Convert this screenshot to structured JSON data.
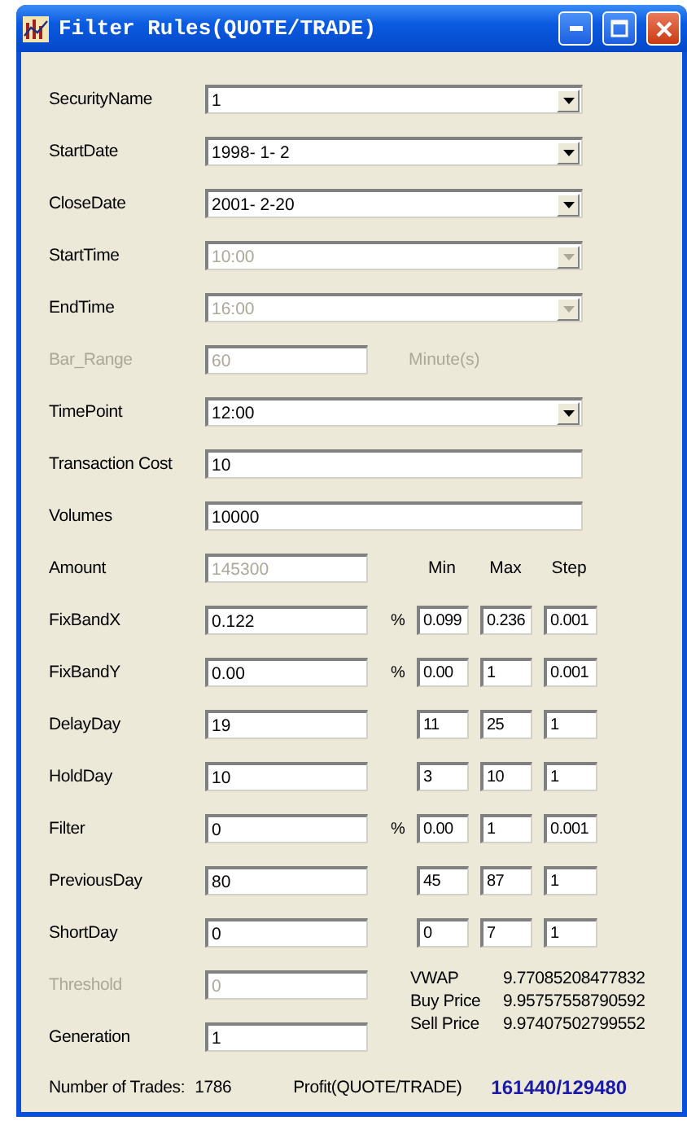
{
  "window": {
    "title": "Filter Rules(QUOTE/TRADE)"
  },
  "rows": [
    {
      "kind": "combo",
      "label": "SecurityName",
      "label_disabled": false,
      "value": "1",
      "disabled": false
    },
    {
      "kind": "combo",
      "label": "StartDate",
      "label_disabled": false,
      "value": "1998- 1- 2",
      "disabled": false
    },
    {
      "kind": "combo",
      "label": "CloseDate",
      "label_disabled": false,
      "value": "2001- 2-20",
      "disabled": false
    },
    {
      "kind": "combo",
      "label": "StartTime",
      "label_disabled": false,
      "value": "10:00",
      "disabled": true
    },
    {
      "kind": "combo",
      "label": "EndTime",
      "label_disabled": false,
      "value": "16:00",
      "disabled": true
    },
    {
      "kind": "short",
      "label": "Bar_Range",
      "label_disabled": true,
      "value": "60",
      "disabled": true,
      "unit": "Minute(s)"
    },
    {
      "kind": "combo",
      "label": "TimePoint",
      "label_disabled": false,
      "value": "12:00",
      "disabled": false
    },
    {
      "kind": "text",
      "label": "Transaction Cost",
      "label_disabled": false,
      "value": "10",
      "disabled": false
    },
    {
      "kind": "text",
      "label": "Volumes",
      "label_disabled": false,
      "value": "10000",
      "disabled": false
    },
    {
      "kind": "short",
      "label": "Amount",
      "label_disabled": false,
      "value": "145300",
      "disabled": true,
      "headers": [
        "Min",
        "Max",
        "Step"
      ]
    },
    {
      "kind": "range",
      "label": "FixBandX",
      "label_disabled": false,
      "value": "0.122",
      "disabled": false,
      "unit": "%",
      "min": "0.099",
      "max": "0.236",
      "step": "0.001"
    },
    {
      "kind": "range",
      "label": "FixBandY",
      "label_disabled": false,
      "value": "0.00",
      "disabled": false,
      "unit": "%",
      "min": "0.00",
      "max": "1",
      "step": "0.001"
    },
    {
      "kind": "range",
      "label": "DelayDay",
      "label_disabled": false,
      "value": "19",
      "disabled": false,
      "min": "11",
      "max": "25",
      "step": "1"
    },
    {
      "kind": "range",
      "label": "HoldDay",
      "label_disabled": false,
      "value": "10",
      "disabled": false,
      "min": "3",
      "max": "10",
      "step": "1"
    },
    {
      "kind": "range",
      "label": "Filter",
      "label_disabled": false,
      "value": "0",
      "disabled": false,
      "unit": "%",
      "min": "0.00",
      "max": "1",
      "step": "0.001"
    },
    {
      "kind": "range",
      "label": "PreviousDay",
      "label_disabled": false,
      "value": "80",
      "disabled": false,
      "min": "45",
      "max": "87",
      "step": "1"
    },
    {
      "kind": "range",
      "label": "ShortDay",
      "label_disabled": false,
      "value": "0",
      "disabled": false,
      "min": "0",
      "max": "7",
      "step": "1"
    }
  ],
  "lower_rows": [
    {
      "kind": "short",
      "label": "Threshold",
      "label_disabled": true,
      "value": "0",
      "disabled": true
    },
    {
      "kind": "short",
      "label": "Generation",
      "label_disabled": false,
      "value": "1",
      "disabled": false
    }
  ],
  "prices": [
    {
      "label": "VWAP",
      "value": "9.77085208477832"
    },
    {
      "label": "Buy Price",
      "value": "9.95757558790592"
    },
    {
      "label": "Sell Price",
      "value": "9.97407502799552"
    }
  ],
  "footer": {
    "trades_label": "Number of Trades:",
    "trades": "1786",
    "profit_label": "Profit(QUOTE/TRADE)",
    "profit": "161440/129480"
  }
}
